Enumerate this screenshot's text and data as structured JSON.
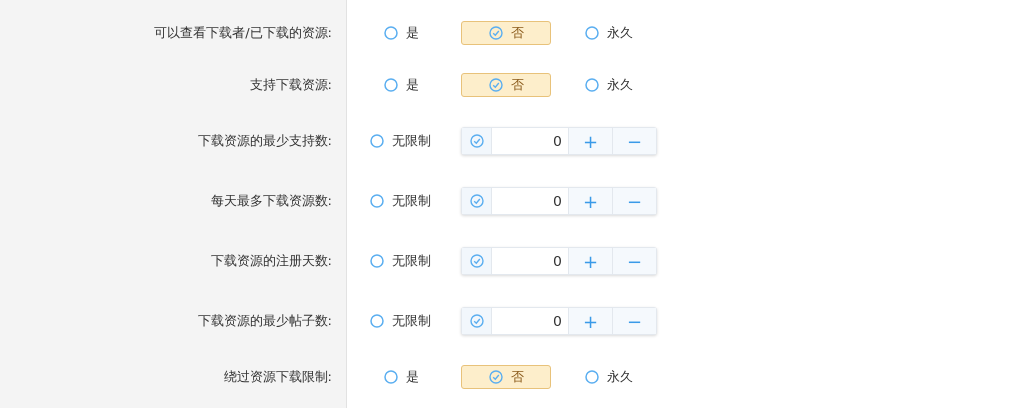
{
  "settings": [
    {
      "kind": "choice",
      "label": "可以查看下载者/已下载的资源:",
      "options": [
        {
          "label": "是",
          "selected": false
        },
        {
          "label": "否",
          "selected": true
        },
        {
          "label": "永久",
          "selected": false
        }
      ]
    },
    {
      "kind": "choice",
      "label": "支持下载资源:",
      "options": [
        {
          "label": "是",
          "selected": false
        },
        {
          "label": "否",
          "selected": true
        },
        {
          "label": "永久",
          "selected": false
        }
      ]
    },
    {
      "kind": "number",
      "label": "下载资源的最少支持数:",
      "unlimited": {
        "label": "无限制",
        "selected": false
      },
      "custom": {
        "selected": true,
        "value": "0",
        "plus": "+",
        "minus": "−"
      }
    },
    {
      "kind": "number",
      "label": "每天最多下载资源数:",
      "unlimited": {
        "label": "无限制",
        "selected": false
      },
      "custom": {
        "selected": true,
        "value": "0",
        "plus": "+",
        "minus": "−"
      }
    },
    {
      "kind": "number",
      "label": "下载资源的注册天数:",
      "unlimited": {
        "label": "无限制",
        "selected": false
      },
      "custom": {
        "selected": true,
        "value": "0",
        "plus": "+",
        "minus": "−"
      }
    },
    {
      "kind": "number",
      "label": "下载资源的最少帖子数:",
      "unlimited": {
        "label": "无限制",
        "selected": false
      },
      "custom": {
        "selected": true,
        "value": "0",
        "plus": "+",
        "minus": "−"
      }
    },
    {
      "kind": "choice",
      "label": "绕过资源下载限制:",
      "options": [
        {
          "label": "是",
          "selected": false
        },
        {
          "label": "否",
          "selected": true
        },
        {
          "label": "永久",
          "selected": false
        }
      ]
    }
  ]
}
